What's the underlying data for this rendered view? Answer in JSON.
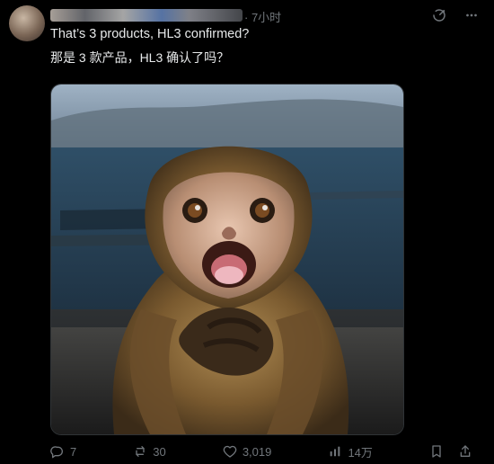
{
  "post": {
    "time": "· 7小时",
    "text_en": "That’s 3 products, HL3 confirmed?",
    "text_zh": "那是 3 款产品，HL3 确认了吗？"
  },
  "actions": {
    "replies": "7",
    "reposts": "30",
    "likes": "3,019",
    "views": "14万"
  },
  "icons": {
    "grok": "grok-icon",
    "more": "more-icon",
    "reply": "reply-icon",
    "repost": "repost-icon",
    "like": "like-icon",
    "views": "views-icon",
    "bookmark": "bookmark-icon",
    "share": "share-icon"
  }
}
